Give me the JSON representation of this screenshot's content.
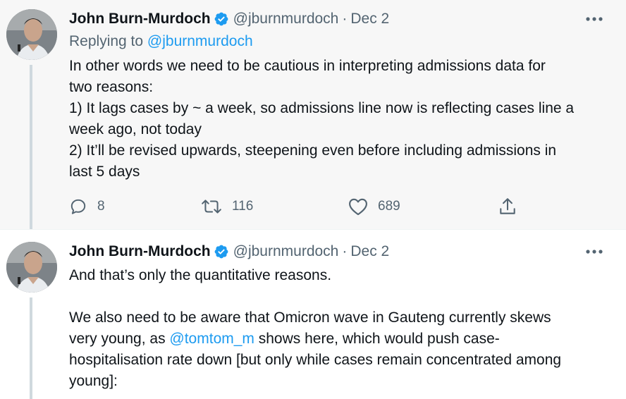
{
  "tweets": [
    {
      "author": {
        "display_name": "John Burn-Murdoch",
        "handle": "@jburnmurdoch",
        "verified": true,
        "avatar_icon": "avatar-photo"
      },
      "separator": "·",
      "date": "Dec 2",
      "replying_prefix": "Replying to",
      "replying_to": "@jburnmurdoch",
      "body": {
        "line1": "In other words we need to be cautious in interpreting admissions data for",
        "line2": "two reasons:",
        "line3": "1) It lags cases by ~ a week, so admissions line now is reflecting cases line a",
        "line4": "week ago, not today",
        "line5": "2) It’ll be revised upwards, steepening even before including admissions in",
        "line6": "last 5 days"
      },
      "actions": {
        "reply_count": "8",
        "retweet_count": "116",
        "like_count": "689"
      }
    },
    {
      "author": {
        "display_name": "John Burn-Murdoch",
        "handle": "@jburnmurdoch",
        "verified": true,
        "avatar_icon": "avatar-photo"
      },
      "separator": "·",
      "date": "Dec 2",
      "body": {
        "line1": "And that’s only the quantitative reasons.",
        "line2": "We also need to be aware that Omicron wave in Gauteng currently skews",
        "line3_pre": "very young, as ",
        "line3_mention": "@tomtom_m",
        "line3_post": " shows here, which would push case-",
        "line4": "hospitalisation rate down [but only while cases remain concentrated among",
        "line5": "young]:"
      }
    }
  ],
  "colors": {
    "text": "#0f1419",
    "secondary": "#536471",
    "link": "#1d9bf0",
    "verified": "#1d9bf0",
    "highlight_bg": "#f7f7f7",
    "thread_line": "#cfd9de"
  },
  "icons": [
    "verified-badge-icon",
    "more-icon",
    "reply-icon",
    "retweet-icon",
    "like-icon",
    "share-icon"
  ]
}
